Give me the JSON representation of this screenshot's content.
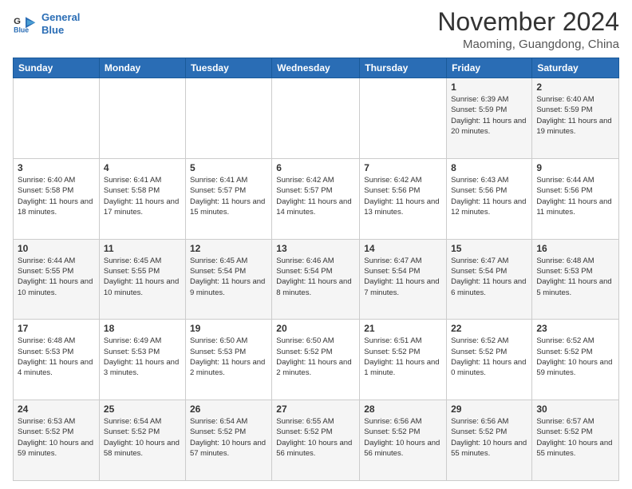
{
  "logo": {
    "line1": "General",
    "line2": "Blue"
  },
  "title": "November 2024",
  "location": "Maoming, Guangdong, China",
  "weekdays": [
    "Sunday",
    "Monday",
    "Tuesday",
    "Wednesday",
    "Thursday",
    "Friday",
    "Saturday"
  ],
  "weeks": [
    [
      {
        "day": "",
        "info": ""
      },
      {
        "day": "",
        "info": ""
      },
      {
        "day": "",
        "info": ""
      },
      {
        "day": "",
        "info": ""
      },
      {
        "day": "",
        "info": ""
      },
      {
        "day": "1",
        "info": "Sunrise: 6:39 AM\nSunset: 5:59 PM\nDaylight: 11 hours and 20 minutes."
      },
      {
        "day": "2",
        "info": "Sunrise: 6:40 AM\nSunset: 5:59 PM\nDaylight: 11 hours and 19 minutes."
      }
    ],
    [
      {
        "day": "3",
        "info": "Sunrise: 6:40 AM\nSunset: 5:58 PM\nDaylight: 11 hours and 18 minutes."
      },
      {
        "day": "4",
        "info": "Sunrise: 6:41 AM\nSunset: 5:58 PM\nDaylight: 11 hours and 17 minutes."
      },
      {
        "day": "5",
        "info": "Sunrise: 6:41 AM\nSunset: 5:57 PM\nDaylight: 11 hours and 15 minutes."
      },
      {
        "day": "6",
        "info": "Sunrise: 6:42 AM\nSunset: 5:57 PM\nDaylight: 11 hours and 14 minutes."
      },
      {
        "day": "7",
        "info": "Sunrise: 6:42 AM\nSunset: 5:56 PM\nDaylight: 11 hours and 13 minutes."
      },
      {
        "day": "8",
        "info": "Sunrise: 6:43 AM\nSunset: 5:56 PM\nDaylight: 11 hours and 12 minutes."
      },
      {
        "day": "9",
        "info": "Sunrise: 6:44 AM\nSunset: 5:56 PM\nDaylight: 11 hours and 11 minutes."
      }
    ],
    [
      {
        "day": "10",
        "info": "Sunrise: 6:44 AM\nSunset: 5:55 PM\nDaylight: 11 hours and 10 minutes."
      },
      {
        "day": "11",
        "info": "Sunrise: 6:45 AM\nSunset: 5:55 PM\nDaylight: 11 hours and 10 minutes."
      },
      {
        "day": "12",
        "info": "Sunrise: 6:45 AM\nSunset: 5:54 PM\nDaylight: 11 hours and 9 minutes."
      },
      {
        "day": "13",
        "info": "Sunrise: 6:46 AM\nSunset: 5:54 PM\nDaylight: 11 hours and 8 minutes."
      },
      {
        "day": "14",
        "info": "Sunrise: 6:47 AM\nSunset: 5:54 PM\nDaylight: 11 hours and 7 minutes."
      },
      {
        "day": "15",
        "info": "Sunrise: 6:47 AM\nSunset: 5:54 PM\nDaylight: 11 hours and 6 minutes."
      },
      {
        "day": "16",
        "info": "Sunrise: 6:48 AM\nSunset: 5:53 PM\nDaylight: 11 hours and 5 minutes."
      }
    ],
    [
      {
        "day": "17",
        "info": "Sunrise: 6:48 AM\nSunset: 5:53 PM\nDaylight: 11 hours and 4 minutes."
      },
      {
        "day": "18",
        "info": "Sunrise: 6:49 AM\nSunset: 5:53 PM\nDaylight: 11 hours and 3 minutes."
      },
      {
        "day": "19",
        "info": "Sunrise: 6:50 AM\nSunset: 5:53 PM\nDaylight: 11 hours and 2 minutes."
      },
      {
        "day": "20",
        "info": "Sunrise: 6:50 AM\nSunset: 5:52 PM\nDaylight: 11 hours and 2 minutes."
      },
      {
        "day": "21",
        "info": "Sunrise: 6:51 AM\nSunset: 5:52 PM\nDaylight: 11 hours and 1 minute."
      },
      {
        "day": "22",
        "info": "Sunrise: 6:52 AM\nSunset: 5:52 PM\nDaylight: 11 hours and 0 minutes."
      },
      {
        "day": "23",
        "info": "Sunrise: 6:52 AM\nSunset: 5:52 PM\nDaylight: 10 hours and 59 minutes."
      }
    ],
    [
      {
        "day": "24",
        "info": "Sunrise: 6:53 AM\nSunset: 5:52 PM\nDaylight: 10 hours and 59 minutes."
      },
      {
        "day": "25",
        "info": "Sunrise: 6:54 AM\nSunset: 5:52 PM\nDaylight: 10 hours and 58 minutes."
      },
      {
        "day": "26",
        "info": "Sunrise: 6:54 AM\nSunset: 5:52 PM\nDaylight: 10 hours and 57 minutes."
      },
      {
        "day": "27",
        "info": "Sunrise: 6:55 AM\nSunset: 5:52 PM\nDaylight: 10 hours and 56 minutes."
      },
      {
        "day": "28",
        "info": "Sunrise: 6:56 AM\nSunset: 5:52 PM\nDaylight: 10 hours and 56 minutes."
      },
      {
        "day": "29",
        "info": "Sunrise: 6:56 AM\nSunset: 5:52 PM\nDaylight: 10 hours and 55 minutes."
      },
      {
        "day": "30",
        "info": "Sunrise: 6:57 AM\nSunset: 5:52 PM\nDaylight: 10 hours and 55 minutes."
      }
    ]
  ],
  "colors": {
    "header_bg": "#2a6db5",
    "header_text": "#ffffff",
    "odd_row": "#f5f5f5",
    "even_row": "#ffffff"
  }
}
